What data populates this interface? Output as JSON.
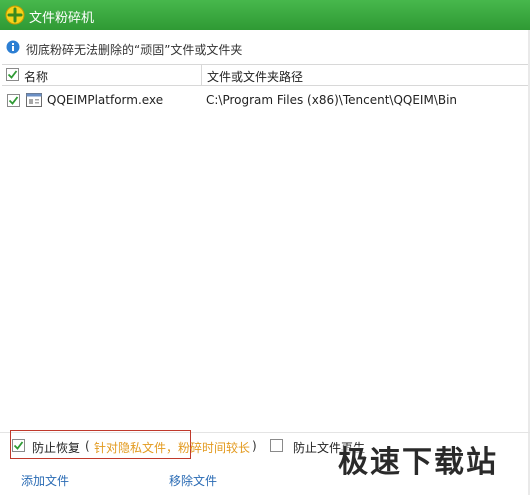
{
  "window": {
    "title": "文件粉碎机"
  },
  "info": {
    "text": "彻底粉碎无法删除的“顽固”文件或文件夹"
  },
  "table": {
    "columns": {
      "name": "名称",
      "path": "文件或文件夹路径"
    },
    "rows": [
      {
        "name": "QQEIMPlatform.exe",
        "path": "C:\\Program Files (x86)\\Tencent\\QQEIM\\Bin",
        "checked": true
      }
    ]
  },
  "options": {
    "prevent_recovery": {
      "label": "防止恢复",
      "hint_open": "(",
      "hint": "针对隐私文件，粉碎时间较长",
      "hint_close": ")",
      "checked": true
    },
    "second_option": {
      "label": "防止文件再生",
      "checked": false
    }
  },
  "actions": {
    "add": "添加文件",
    "remove": "移除文件"
  },
  "watermark": "极速下载站",
  "colors": {
    "titlebar": "#3aa83f",
    "link": "#2a6bb4",
    "hint": "#e39a1e",
    "highlight_border": "#c0392b"
  },
  "icons": {
    "title": "shredder-icon",
    "info": "info-icon",
    "file": "exe-file-icon"
  }
}
